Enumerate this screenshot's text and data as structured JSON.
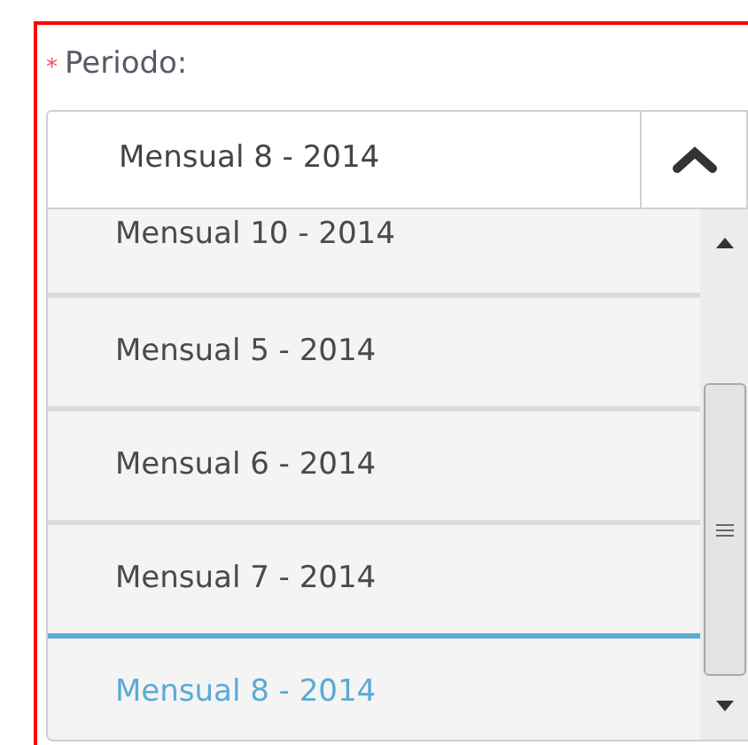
{
  "field": {
    "label": "Periodo:",
    "required_mark": "*",
    "value": "Mensual 8 - 2014",
    "expanded": true
  },
  "options": [
    {
      "label": "Mensual 10 - 2014",
      "selected": false
    },
    {
      "label": "Mensual 5 - 2014",
      "selected": false
    },
    {
      "label": "Mensual 6 - 2014",
      "selected": false
    },
    {
      "label": "Mensual 7 - 2014",
      "selected": false
    },
    {
      "label": "Mensual 8 - 2014",
      "selected": true
    }
  ]
}
